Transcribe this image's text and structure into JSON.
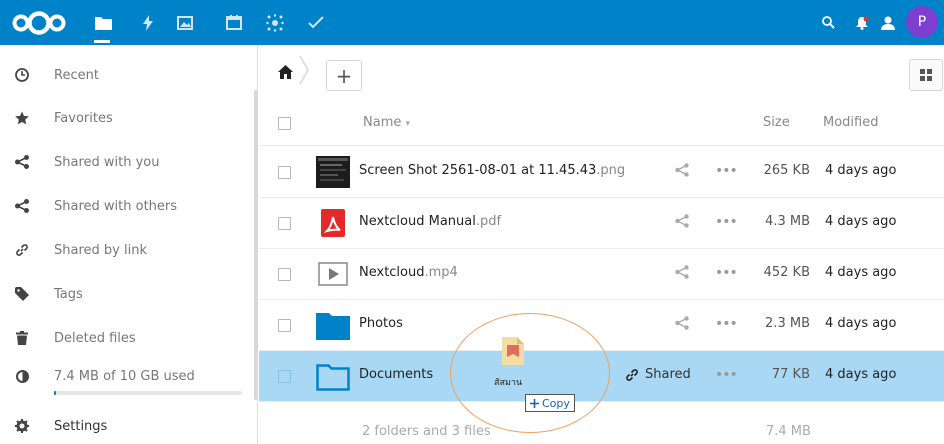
{
  "header": {
    "nav": [
      "files-icon",
      "activity-icon",
      "gallery-icon",
      "calendar-icon",
      "circles-icon",
      "tasks-icon"
    ],
    "avatar_letter": "P",
    "colors": {
      "brand": "#0082c9",
      "avatar": "#7d3ed1"
    }
  },
  "sidebar": {
    "items": [
      {
        "label": "Recent",
        "icon": "clock-icon"
      },
      {
        "label": "Favorites",
        "icon": "star-icon"
      },
      {
        "label": "Shared with you",
        "icon": "share-icon"
      },
      {
        "label": "Shared with others",
        "icon": "share-icon"
      },
      {
        "label": "Shared by link",
        "icon": "link-icon"
      },
      {
        "label": "Tags",
        "icon": "tag-icon"
      },
      {
        "label": "Deleted files",
        "icon": "trash-icon"
      },
      {
        "label": "7.4 MB of 10 GB used",
        "icon": "quota-pie-icon"
      },
      {
        "label": "Settings",
        "icon": "gear-icon"
      }
    ],
    "quota_fraction": 0.00074
  },
  "toolbar": {
    "add_label": "+"
  },
  "table": {
    "columns": {
      "name": "Name",
      "sort_indicator": "▾",
      "size": "Size",
      "modified": "Modified"
    },
    "rows": [
      {
        "name": "Screen Shot 2561-08-01 at 11.45.43",
        "ext": ".png",
        "size": "265 KB",
        "modified": "4 days ago",
        "type": "image"
      },
      {
        "name": "Nextcloud Manual",
        "ext": ".pdf",
        "size": "4.3 MB",
        "modified": "4 days ago",
        "type": "pdf"
      },
      {
        "name": "Nextcloud",
        "ext": ".mp4",
        "size": "452 KB",
        "modified": "4 days ago",
        "type": "video"
      },
      {
        "name": "Photos",
        "ext": "",
        "size": "2.3 MB",
        "modified": "4 days ago",
        "type": "folder"
      },
      {
        "name": "Documents",
        "ext": "",
        "size": "77 KB",
        "modified": "4 days ago",
        "type": "folder",
        "shared_label": "Shared"
      }
    ],
    "more_glyph": "•••",
    "summary": "2 folders and 3 files",
    "summary_size": "7.4 MB"
  },
  "drag": {
    "file_label": "สัสมาน",
    "copy_label": "Copy"
  }
}
